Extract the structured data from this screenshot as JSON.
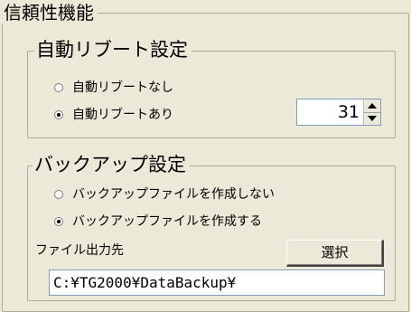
{
  "reliability": {
    "title": "信頼性機能",
    "auto_reboot": {
      "title": "自動リブート設定",
      "options": [
        {
          "label": "自動リブートなし",
          "checked": false
        },
        {
          "label": "自動リブートあり",
          "checked": true
        }
      ],
      "spin_value": "31"
    },
    "backup": {
      "title": "バックアップ設定",
      "options": [
        {
          "label": "バックアップファイルを作成しない",
          "checked": false
        },
        {
          "label": "バックアップファイルを作成する",
          "checked": true
        }
      ],
      "output_label": "ファイル出力先",
      "select_button": "選択",
      "output_path": "C:¥TG2000¥DataBackup¥"
    }
  }
}
